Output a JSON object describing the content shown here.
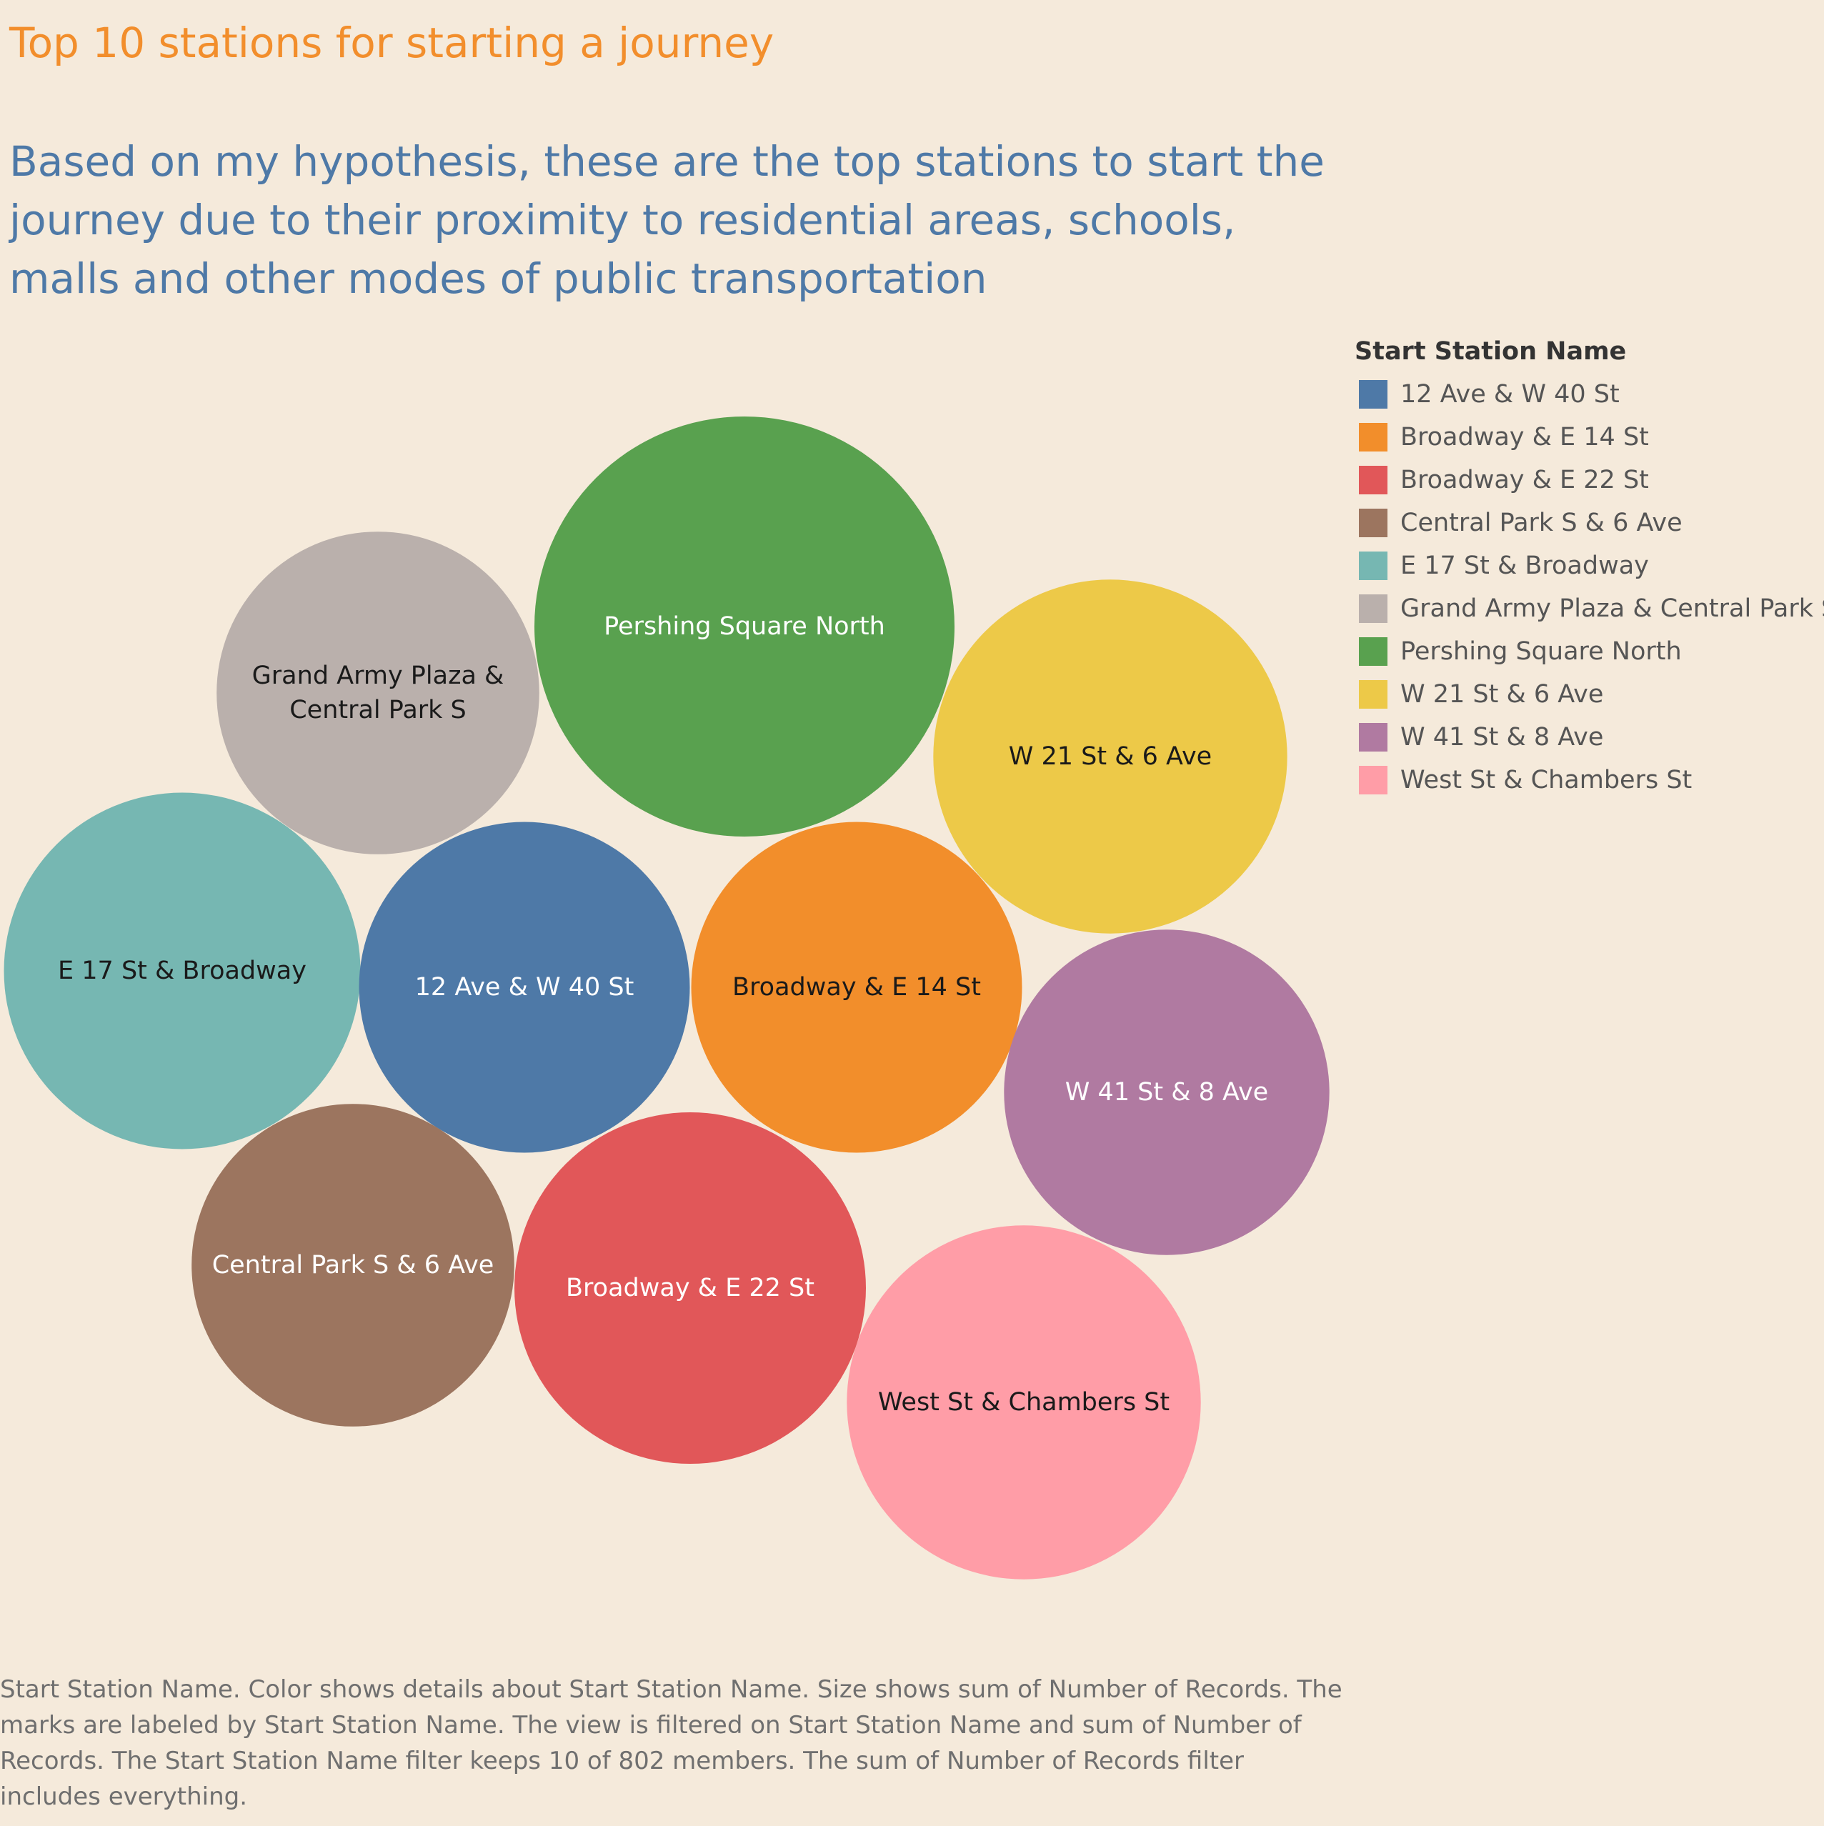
{
  "title": "Top 10 stations for starting a journey",
  "subtitle": "Based on my hypothesis, these  are the top stations to start the journey due to their proximity to residential areas, schools, malls and other modes of public transportation",
  "caption": "Start Station Name.  Color shows details about Start Station Name.  Size shows sum of Number of Records.  The marks are labeled by Start Station Name. The view is filtered on Start Station Name and sum of Number of Records. The Start Station Name filter keeps 10 of 802 members. The sum of Number of Records filter includes everything.",
  "chart_data": {
    "type": "bubble",
    "size_measure": "sum of Number of Records",
    "legend": {
      "title": "Start Station Name",
      "placement": "right",
      "items": [
        {
          "name": "12 Ave & W 40 St",
          "color": "#4e79a7"
        },
        {
          "name": "Broadway & E 14 St",
          "color": "#f28e2b"
        },
        {
          "name": "Broadway & E 22 St",
          "color": "#e15759"
        },
        {
          "name": "Central Park S & 6 Ave",
          "color": "#9c755f"
        },
        {
          "name": "E 17 St & Broadway",
          "color": "#76b7b2"
        },
        {
          "name": "Grand Army Plaza & Central Park S",
          "color": "#bab0ac"
        },
        {
          "name": "Pershing Square North",
          "color": "#59a14f"
        },
        {
          "name": "W 21 St & 6 Ave",
          "color": "#edc948"
        },
        {
          "name": "W 41 St & 8 Ave",
          "color": "#b07aa1"
        },
        {
          "name": "West St & Chambers St",
          "color": "#ff9da7"
        }
      ]
    },
    "bubbles": [
      {
        "name": "Pershing Square North",
        "label_lines": [
          "Pershing Square North"
        ],
        "color": "#59a14f",
        "label_color": "#ffffff",
        "relative_size": 1.0
      },
      {
        "name": "W 21 St & 6 Ave",
        "label_lines": [
          "W 21 St & 6 Ave"
        ],
        "color": "#edc948",
        "label_color": "#1a1a1a",
        "relative_size": 0.71
      },
      {
        "name": "West St & Chambers St",
        "label_lines": [
          "West St & Chambers St"
        ],
        "color": "#ff9da7",
        "label_color": "#1a1a1a",
        "relative_size": 0.71
      },
      {
        "name": "E 17 St & Broadway",
        "label_lines": [
          "E 17 St & Broadway"
        ],
        "color": "#76b7b2",
        "label_color": "#1a1a1a",
        "relative_size": 0.72
      },
      {
        "name": "Broadway & E 22 St",
        "label_lines": [
          "Broadway & E 22 St"
        ],
        "color": "#e15759",
        "label_color": "#ffffff",
        "relative_size": 0.7
      },
      {
        "name": "Broadway & E 14 St",
        "label_lines": [
          "Broadway & E 14 St"
        ],
        "color": "#f28e2b",
        "label_color": "#1a1a1a",
        "relative_size": 0.62
      },
      {
        "name": "12 Ave & W 40 St",
        "label_lines": [
          "12 Ave & W 40 St"
        ],
        "color": "#4e79a7",
        "label_color": "#ffffff",
        "relative_size": 0.62
      },
      {
        "name": "W 41 St & 8 Ave",
        "label_lines": [
          "W 41 St & 8 Ave"
        ],
        "color": "#b07aa1",
        "label_color": "#ffffff",
        "relative_size": 0.6
      },
      {
        "name": "Grand Army Plaza & Central Park S",
        "label_lines": [
          "Grand Army Plaza &",
          "Central Park S"
        ],
        "color": "#bab0ac",
        "label_color": "#1a1a1a",
        "relative_size": 0.59
      },
      {
        "name": "Central Park S & 6 Ave",
        "label_lines": [
          "Central Park S & 6 Ave"
        ],
        "color": "#9c755f",
        "label_color": "#ffffff",
        "relative_size": 0.59
      }
    ]
  }
}
